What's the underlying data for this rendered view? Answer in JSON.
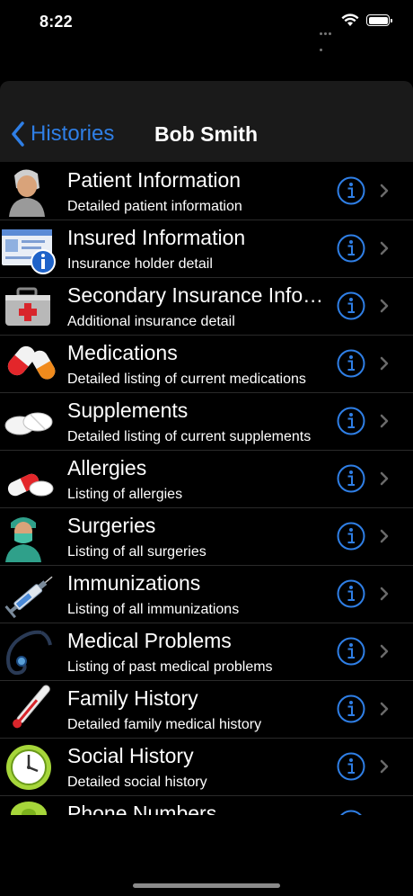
{
  "status_bar": {
    "time": "8:22"
  },
  "nav": {
    "back_label": "Histories",
    "title": "Bob Smith"
  },
  "rows": [
    {
      "title": "Patient Information",
      "subtitle": "Detailed patient information",
      "icon": "patient-icon"
    },
    {
      "title": "Insured Information",
      "subtitle": "Insurance holder detail",
      "icon": "insurance-card-icon"
    },
    {
      "title": "Secondary Insurance Info…",
      "subtitle": "Additional insurance detail",
      "icon": "first-aid-kit-icon"
    },
    {
      "title": "Medications",
      "subtitle": "Detailed listing of current medications",
      "icon": "capsule-icon"
    },
    {
      "title": "Supplements",
      "subtitle": "Detailed listing of current supplements",
      "icon": "tablets-icon"
    },
    {
      "title": "Allergies",
      "subtitle": "Listing of allergies",
      "icon": "pills-icon"
    },
    {
      "title": "Surgeries",
      "subtitle": "Listing of all surgeries",
      "icon": "surgeon-icon"
    },
    {
      "title": "Immunizations",
      "subtitle": "Listing of all immunizations",
      "icon": "syringe-icon"
    },
    {
      "title": "Medical Problems",
      "subtitle": "Listing of past medical problems",
      "icon": "stethoscope-icon"
    },
    {
      "title": "Family History",
      "subtitle": "Detailed family medical history",
      "icon": "thermometer-icon"
    },
    {
      "title": "Social History",
      "subtitle": "Detailed social history",
      "icon": "clock-icon"
    },
    {
      "title": "Phone Numbers",
      "subtitle": "",
      "icon": "phone-icon"
    }
  ],
  "colors": {
    "accent": "#2f7fe6",
    "background": "#000000",
    "navbar": "#1a1a1a"
  }
}
